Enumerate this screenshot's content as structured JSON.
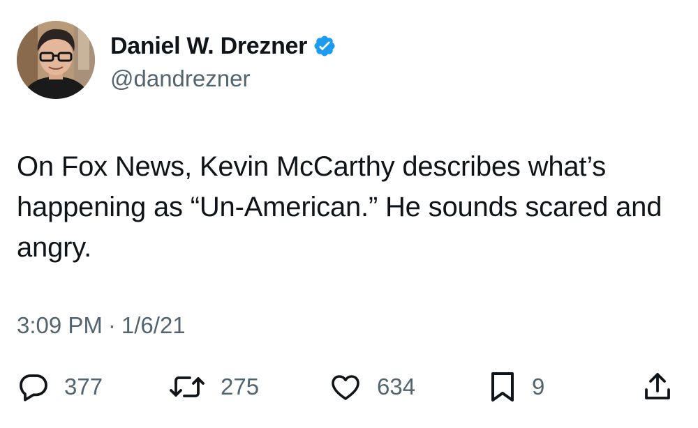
{
  "author": {
    "display_name": "Daniel W. Drezner",
    "handle": "@dandrezner",
    "verified": true,
    "avatar_icon": "profile-photo"
  },
  "tweet": {
    "text": "On Fox News, Kevin McCarthy describes what’s happening as “Un-American.” He sounds scared and angry."
  },
  "meta": {
    "time": "3:09 PM",
    "separator": "·",
    "date": "1/6/21"
  },
  "actions": {
    "reply": {
      "icon": "reply-icon",
      "count": "377"
    },
    "retweet": {
      "icon": "retweet-icon",
      "count": "275"
    },
    "like": {
      "icon": "heart-icon",
      "count": "634"
    },
    "bookmark": {
      "icon": "bookmark-icon",
      "count": "9"
    },
    "share": {
      "icon": "share-icon"
    }
  },
  "colors": {
    "text_primary": "#0f1419",
    "text_secondary": "#536471",
    "verified_blue": "#1d9bf0",
    "background": "#ffffff"
  }
}
